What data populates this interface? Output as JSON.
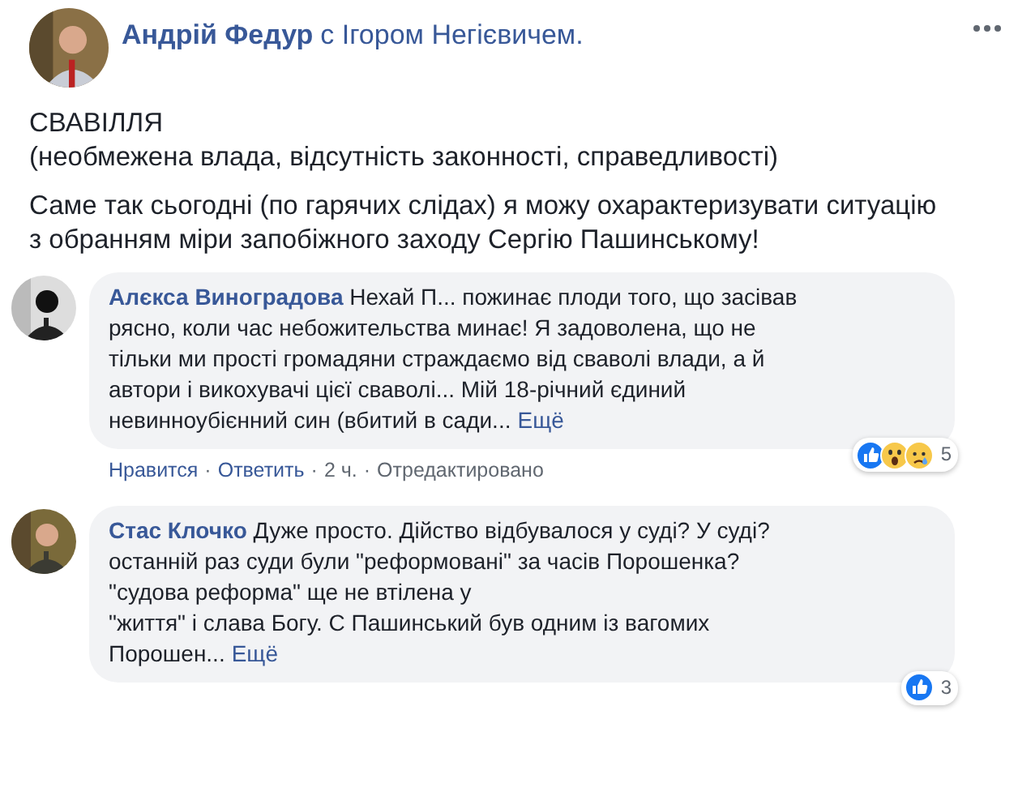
{
  "post": {
    "author": "Андрій Федур",
    "with_text": "с Ігором Негієвичем.",
    "paragraphs": [
      [
        "СВАВІЛЛЯ",
        "(необмежена влада, відсутність законності, справедливості)"
      ],
      [
        "Саме так сьогодні (по гарячих слідах) я можу охарактеризувати ситуацію з обранням міри запобіжного заходу Сергію Пашинському!"
      ]
    ]
  },
  "comments": [
    {
      "author": "Алєкса Виноградова",
      "lines": [
        "Нехай П... пожинає плоди того, що засівав",
        "рясно, коли час небожительства минає! Я задоволена, що не",
        "тільки ми прості громадяни страждаємо від сваволі влади, а й",
        "автори і викохувачі цієї сваволі... Мій 18-річний єдиний",
        "невинноубієнний син (вбитий в сади..."
      ],
      "more": "Ещё",
      "reactions": [
        {
          "kind": "like"
        },
        {
          "kind": "wow"
        },
        {
          "kind": "sad"
        }
      ],
      "reaction_count": "5",
      "actions": [
        "Нравится",
        "Ответить",
        "2 ч.",
        "Отредактировано"
      ],
      "separator": "·"
    },
    {
      "author": "Стас Клочко",
      "lines": [
        "Дуже просто. Дійство відбувалося у суді? У суді?",
        "останній раз суди були \"реформовані\" за часів Порошенка?",
        "\"судова реформа\" ще не втілена у",
        "\"життя\" і слава Богу. С Пашинський був одним із вагомих",
        "Порошен..."
      ],
      "more": "Ещё",
      "reactions": [
        {
          "kind": "like"
        }
      ],
      "reaction_count": "3"
    }
  ]
}
